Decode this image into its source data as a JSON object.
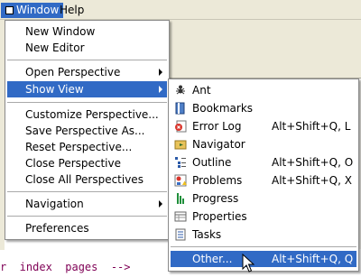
{
  "menubar": {
    "window_label": "Window",
    "help_label": "Help"
  },
  "window_menu": {
    "items": [
      {
        "label": "New Window"
      },
      {
        "label": "New Editor"
      },
      {
        "label": "Open Perspective"
      },
      {
        "label": "Show View"
      },
      {
        "label": "Customize Perspective..."
      },
      {
        "label": "Save Perspective As..."
      },
      {
        "label": "Reset Perspective..."
      },
      {
        "label": "Close Perspective"
      },
      {
        "label": "Close All Perspectives"
      },
      {
        "label": "Navigation"
      },
      {
        "label": "Preferences"
      }
    ]
  },
  "show_view_menu": {
    "items": [
      {
        "label": "Ant",
        "icon": "ant-icon"
      },
      {
        "label": "Bookmarks",
        "icon": "bookmarks-icon"
      },
      {
        "label": "Error Log",
        "shortcut": "Alt+Shift+Q, L",
        "icon": "error-log-icon"
      },
      {
        "label": "Navigator",
        "icon": "navigator-icon"
      },
      {
        "label": "Outline",
        "shortcut": "Alt+Shift+Q, O",
        "icon": "outline-icon"
      },
      {
        "label": "Problems",
        "shortcut": "Alt+Shift+Q, X",
        "icon": "problems-icon"
      },
      {
        "label": "Progress",
        "icon": "progress-icon"
      },
      {
        "label": "Properties",
        "icon": "properties-icon"
      },
      {
        "label": "Tasks",
        "icon": "tasks-icon"
      },
      {
        "label": "Other...",
        "shortcut": "Alt+Shift+Q, Q"
      }
    ]
  },
  "editor": {
    "code_line": "r  index  pages  -->"
  },
  "colors": {
    "highlight": "#316ac5",
    "menubar_bg": "#ece9d8",
    "code_keyword": "#7f0055"
  }
}
